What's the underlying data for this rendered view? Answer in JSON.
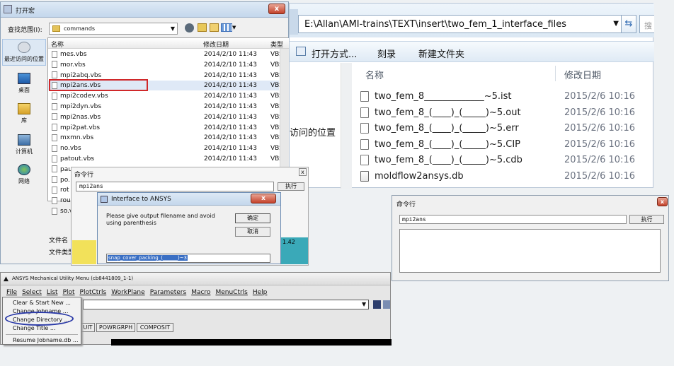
{
  "open_dialog": {
    "title": "打开宏",
    "lookin_label": "查找范围(I):",
    "lookin_value": "commands",
    "col_name": "名称",
    "col_date": "修改日期",
    "col_type": "类型",
    "files": [
      {
        "name": "mes.vbs",
        "date": "2014/2/10 11:43",
        "type": "VBS"
      },
      {
        "name": "mor.vbs",
        "date": "2014/2/10 11:43",
        "type": "VBS"
      },
      {
        "name": "mpi2abq.vbs",
        "date": "2014/2/10 11:43",
        "type": "VBS"
      },
      {
        "name": "mpi2ans.vbs",
        "date": "2014/2/10 11:43",
        "type": "VBS"
      },
      {
        "name": "mpi2codev.vbs",
        "date": "2014/2/10 11:43",
        "type": "VBS"
      },
      {
        "name": "mpi2dyn.vbs",
        "date": "2014/2/10 11:43",
        "type": "VBS"
      },
      {
        "name": "mpi2nas.vbs",
        "date": "2014/2/10 11:43",
        "type": "VBS"
      },
      {
        "name": "mpi2pat.vbs",
        "date": "2014/2/10 11:43",
        "type": "VBS"
      },
      {
        "name": "mxmn.vbs",
        "date": "2014/2/10 11:43",
        "type": "VBS"
      },
      {
        "name": "no.vbs",
        "date": "2014/2/10 11:43",
        "type": "VBS"
      },
      {
        "name": "patout.vbs",
        "date": "2014/2/10 11:43",
        "type": "VBS"
      }
    ],
    "partial_files": [
      "pau",
      "po.",
      "rot",
      "rou",
      "so.v"
    ],
    "nav": [
      {
        "label": "最近访问的位置"
      },
      {
        "label": "桌面"
      },
      {
        "label": "库"
      },
      {
        "label": "计算机"
      },
      {
        "label": "网络"
      }
    ],
    "filename_label": "文件名",
    "filetype_label": "文件类型"
  },
  "explorer": {
    "path": "E:\\Allan\\AMI-trains\\TEXT\\insert\\two_fem_1_interface_files",
    "toolbar": {
      "open_with": "打开方式...",
      "burn": "刻录",
      "new_folder": "新建文件夹"
    },
    "col_name": "名称",
    "col_date": "修改日期",
    "files": [
      {
        "name": "two_fem_8_____________~5.ist",
        "date": "2015/2/6 10:16"
      },
      {
        "name": "two_fem_8_(____)_(_____)~5.out",
        "date": "2015/2/6 10:16"
      },
      {
        "name": "two_fem_8_(____)_(_____)~5.err",
        "date": "2015/2/6 10:16"
      },
      {
        "name": "two_fem_8_(____)_(_____)~5.CIP",
        "date": "2015/2/6 10:16"
      },
      {
        "name": "two_fem_8_(____)_(_____)~5.cdb",
        "date": "2015/2/6 10:16"
      },
      {
        "name": "moldflow2ansys.db",
        "date": "2015/2/6 10:16"
      }
    ],
    "side_text": "访问的位置"
  },
  "cmd_small": {
    "title": "命令行",
    "input": "mpi2ans",
    "run": "执行"
  },
  "interface": {
    "title": "Interface to ANSYS",
    "prompt": "Please give output filename and avoid using parenthesis",
    "ok": "确定",
    "cancel": "取消",
    "input_value": "snap_cover_packing_(______)~3",
    "bg_value": "1.42"
  },
  "cmd_large": {
    "title": "命令行",
    "input": "mpi2ans",
    "run": "执行"
  },
  "ansys": {
    "title": "ANSYS Mechanical Utility Menu (cb8441809_1-1)",
    "menus": [
      "File",
      "Select",
      "List",
      "Plot",
      "PlotCtrls",
      "WorkPlane",
      "Parameters",
      "Macro",
      "MenuCtrls",
      "Help"
    ],
    "dropdown": [
      "Clear & Start New ...",
      "Change Jobname ...",
      "Change Directory ...",
      "Change Title ...",
      "Resume Jobname.db ..."
    ],
    "toolbar_buttons": [
      "UIT",
      "POWRGRPH",
      "COMPOSIT"
    ]
  },
  "colors": {
    "highlight_red": "#d0282a",
    "highlight_blue": "#2b3aa8",
    "selection": "#3a6fc4"
  }
}
